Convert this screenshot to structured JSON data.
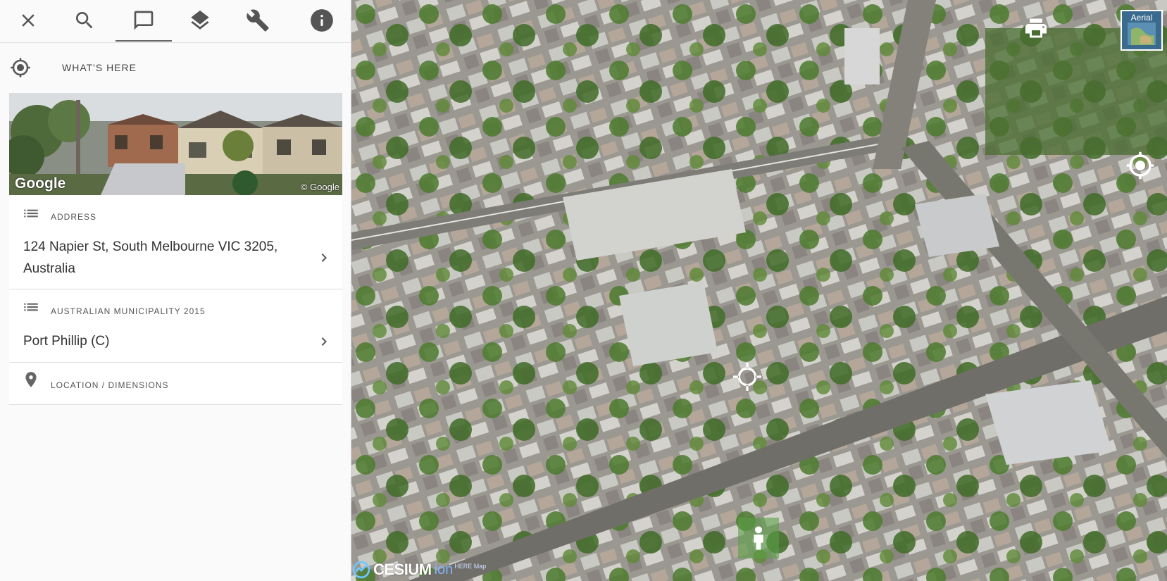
{
  "toolbar": {
    "icons": [
      "close-icon",
      "search-icon",
      "comment-icon",
      "layers-icon",
      "wrench-icon",
      "info-icon"
    ],
    "active": "comment-icon"
  },
  "whats_here": {
    "label": "WHAT'S HERE",
    "icon": "crosshair-icon"
  },
  "photo": {
    "brand_left": "Google",
    "brand_right": "© Google"
  },
  "cards": {
    "address": {
      "header": "ADDRESS",
      "value_line1": "124 Napier St, South Melbourne VIC 3205,",
      "value_line2": "Australia",
      "icon": "list-icon"
    },
    "municipality": {
      "header": "AUSTRALIAN MUNICIPALITY 2015",
      "value": "Port Phillip (C)",
      "icon": "list-icon"
    },
    "location": {
      "header": "LOCATION / DIMENSIONS",
      "icon": "map-pin-icon"
    }
  },
  "map": {
    "basemap_label": "Aerial",
    "attribution": {
      "cesium": "CESIUM",
      "ion": "ion",
      "here": "HERE Map"
    },
    "colors": {
      "panel_bg": "#fafafa",
      "card_bg": "#ffffff",
      "text": "#333333",
      "accent": "#555555"
    }
  }
}
